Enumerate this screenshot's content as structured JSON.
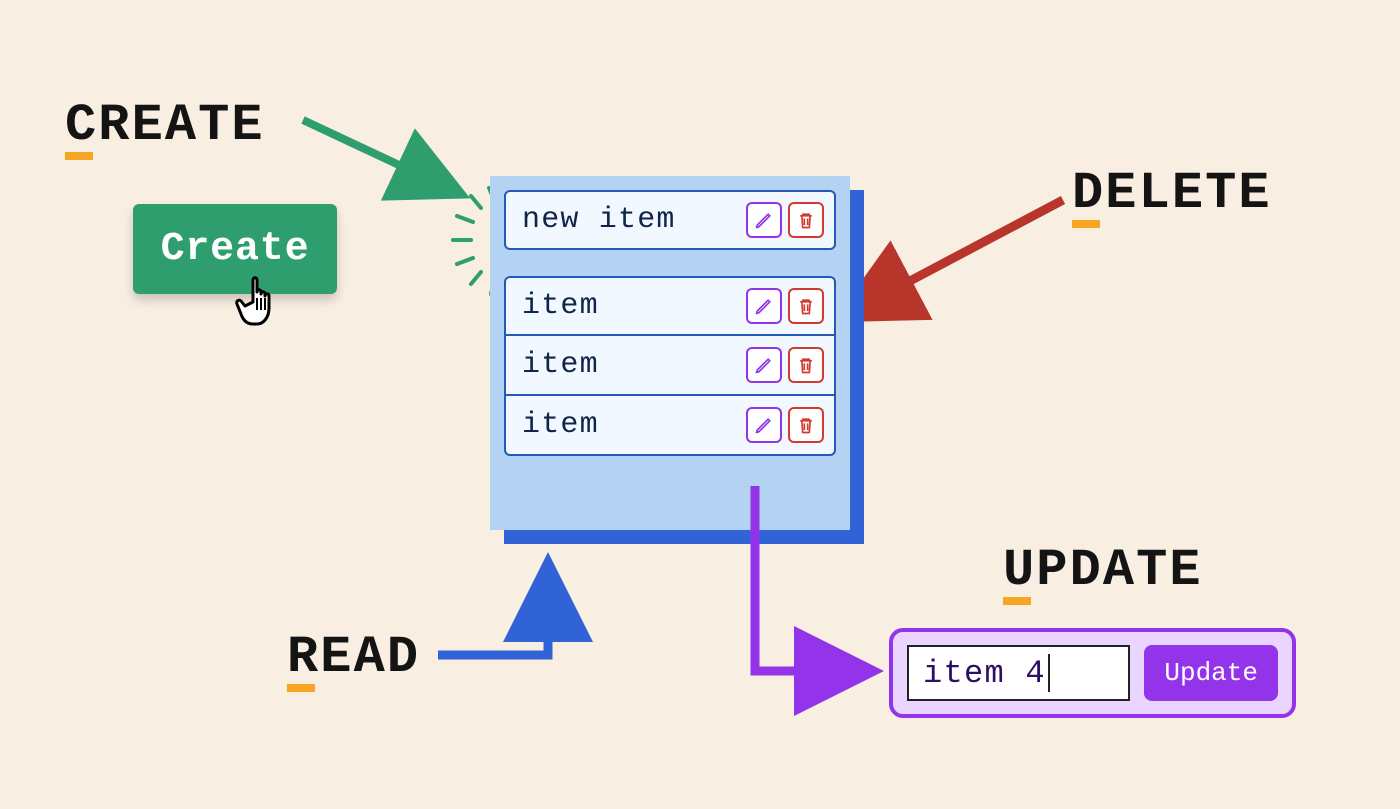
{
  "headings": {
    "create": "CREATE",
    "read": "READ",
    "update": "UPDATE",
    "delete": "DELETE"
  },
  "create_button_label": "Create",
  "list": {
    "new_item_label": "new item",
    "items": [
      "item",
      "item",
      "item"
    ]
  },
  "update_form": {
    "input_value": "item 4",
    "button_label": "Update"
  },
  "colors": {
    "bg": "#f9eee2",
    "panel": "#b4d3f3",
    "panel_shadow": "#2f63d6",
    "row_bg": "#f1f8ff",
    "row_border": "#245ab1",
    "green": "#2f9e6e",
    "green_arrow": "#2f9e6e",
    "blue_arrow": "#2f63d6",
    "purple": "#9333ea",
    "red": "#c0392b",
    "orange": "#f5a623"
  }
}
